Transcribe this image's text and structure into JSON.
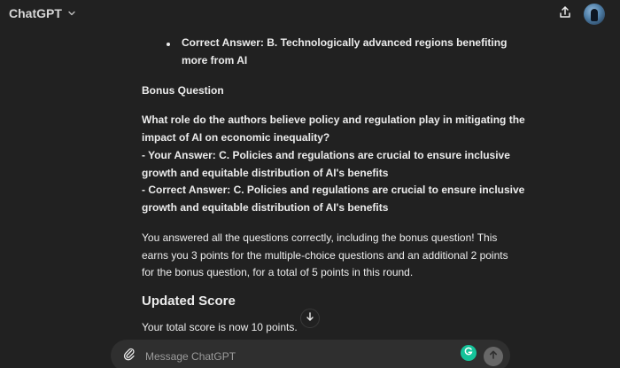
{
  "header": {
    "title": "ChatGPT"
  },
  "message": {
    "bullet_line1": "Correct Answer: B. Technologically advanced regions benefiting",
    "bullet_line2": "more from AI",
    "bonus_heading": "Bonus Question",
    "question_line1": "What role do the authors believe policy and regulation play in mitigating the",
    "question_line2": "impact of AI on economic inequality?",
    "your_answer_line1": "- Your Answer: C. Policies and regulations are crucial to ensure inclusive",
    "your_answer_line2": "growth and equitable distribution of AI's benefits",
    "correct_answer_line1": "- Correct Answer: C. Policies and regulations are crucial to ensure inclusive",
    "correct_answer_line2": "growth and equitable distribution of AI's benefits",
    "summary_line1": "You answered all the questions correctly, including the bonus question! This",
    "summary_line2": "earns you 3 points for the multiple-choice questions and an additional 2 points",
    "summary_line3": "for the bonus question, for a total of 5 points in this round.",
    "updated_score_heading": "Updated Score",
    "total_line": "Your total score is now 10 points."
  },
  "composer": {
    "placeholder": "Message ChatGPT"
  },
  "colors": {
    "background": "#212121",
    "composer": "#2f2f2f",
    "text": "#ececec",
    "grammarly": "#15c39a",
    "send_disabled": "#676767"
  },
  "icons": {
    "dropdown": "chevron-down-icon",
    "share": "share-icon",
    "scroll": "arrow-down-icon",
    "attach": "paperclip-icon",
    "grammarly": "grammarly-icon",
    "send": "arrow-up-icon"
  }
}
